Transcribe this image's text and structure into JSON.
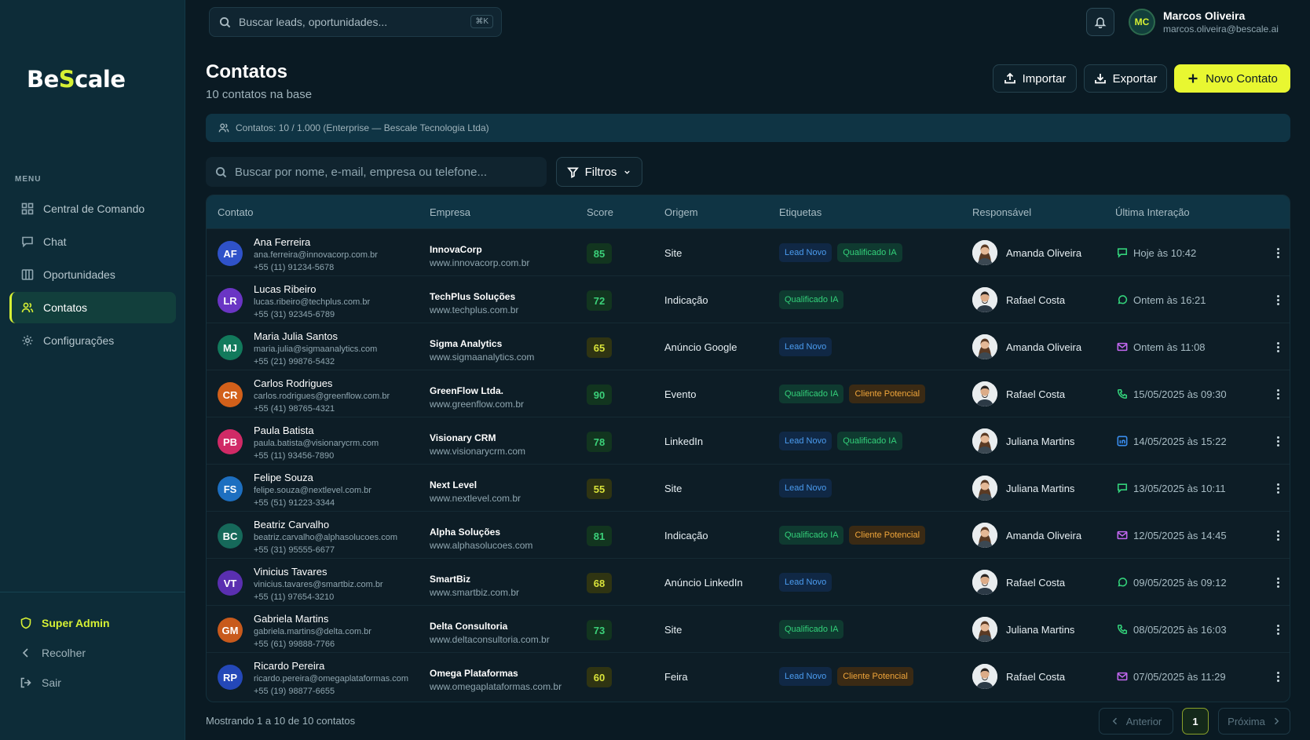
{
  "brand": {
    "part1": "Be",
    "part2": "S",
    "part3": "cale"
  },
  "colors": {
    "accent": "#e8f731",
    "bg": "#0a1a23",
    "sidebar": "#0d2c38"
  },
  "sidebar": {
    "menu_title": "MENU",
    "items": [
      {
        "label": "Central de Comando",
        "icon": "grid-icon"
      },
      {
        "label": "Chat",
        "icon": "chat-icon"
      },
      {
        "label": "Oportunidades",
        "icon": "columns-icon"
      },
      {
        "label": "Contatos",
        "icon": "users-icon",
        "active": true
      },
      {
        "label": "Configurações",
        "icon": "gear-icon"
      }
    ],
    "bottom": {
      "admin": "Super Admin",
      "collapse": "Recolher",
      "logout": "Sair"
    }
  },
  "topbar": {
    "search_placeholder": "Buscar leads, oportunidades...",
    "shortcut": "⌘K",
    "user": {
      "initials": "MC",
      "name": "Marcos Oliveira",
      "email": "marcos.oliveira@bescale.ai"
    }
  },
  "page": {
    "title": "Contatos",
    "subtitle": "10 contatos na base",
    "import_label": "Importar",
    "export_label": "Exportar",
    "new_label": "Novo Contato",
    "quota": "Contatos: 10 / 1.000 (Enterprise — Bescale Tecnologia Ltda)",
    "search_placeholder": "Buscar por nome, e-mail, empresa ou telefone...",
    "filter_label": "Filtros"
  },
  "table": {
    "headers": [
      "Contato",
      "Empresa",
      "Score",
      "Origem",
      "Etiquetas",
      "Responsável",
      "Última Interação"
    ],
    "rows": [
      {
        "initials": "AF",
        "avatar_color": "#2f52c9",
        "name": "Ana Ferreira",
        "email": "ana.ferreira@innovacorp.com.br",
        "phone": "+55 (11) 91234-5678",
        "company": "InnovaCorp",
        "site": "www.innovacorp.com.br",
        "score": "85",
        "score_level": "high",
        "origin": "Site",
        "tags": [
          "Lead Novo",
          "Qualificado IA"
        ],
        "owner": "Amanda Oliveira",
        "owner_gender": "f",
        "channel": "chat",
        "last": "Hoje às 10:42"
      },
      {
        "initials": "LR",
        "avatar_color": "#6a35c4",
        "name": "Lucas Ribeiro",
        "email": "lucas.ribeiro@techplus.com.br",
        "phone": "+55 (31) 92345-6789",
        "company": "TechPlus Soluções",
        "site": "www.techplus.com.br",
        "score": "72",
        "score_level": "high",
        "origin": "Indicação",
        "tags": [
          "Qualificado IA"
        ],
        "owner": "Rafael Costa",
        "owner_gender": "m",
        "channel": "whatsapp",
        "last": "Ontem às 16:21"
      },
      {
        "initials": "MJ",
        "avatar_color": "#127a5c",
        "name": "Maria Julia Santos",
        "email": "maria.julia@sigmaanalytics.com",
        "phone": "+55 (21) 99876-5432",
        "company": "Sigma Analytics",
        "site": "www.sigmaanalytics.com",
        "score": "65",
        "score_level": "mid",
        "origin": "Anúncio Google",
        "tags": [
          "Lead Novo"
        ],
        "owner": "Amanda Oliveira",
        "owner_gender": "f",
        "channel": "email",
        "last": "Ontem às 11:08"
      },
      {
        "initials": "CR",
        "avatar_color": "#d2601a",
        "name": "Carlos Rodrigues",
        "email": "carlos.rodrigues@greenflow.com.br",
        "phone": "+55 (41) 98765-4321",
        "company": "GreenFlow Ltda.",
        "site": "www.greenflow.com.br",
        "score": "90",
        "score_level": "high",
        "origin": "Evento",
        "tags": [
          "Qualificado IA",
          "Cliente Potencial"
        ],
        "owner": "Rafael Costa",
        "owner_gender": "m",
        "channel": "phone",
        "last": "15/05/2025 às 09:30"
      },
      {
        "initials": "PB",
        "avatar_color": "#d02a66",
        "name": "Paula Batista",
        "email": "paula.batista@visionarycrm.com",
        "phone": "+55 (11) 93456-7890",
        "company": "Visionary CRM",
        "site": "www.visionarycrm.com",
        "score": "78",
        "score_level": "high",
        "origin": "LinkedIn",
        "tags": [
          "Lead Novo",
          "Qualificado IA"
        ],
        "owner": "Juliana Martins",
        "owner_gender": "f",
        "channel": "linkedin",
        "last": "14/05/2025 às 15:22"
      },
      {
        "initials": "FS",
        "avatar_color": "#1d6fc0",
        "name": "Felipe Souza",
        "email": "felipe.souza@nextlevel.com.br",
        "phone": "+55 (51) 91223-3344",
        "company": "Next Level",
        "site": "www.nextlevel.com.br",
        "score": "55",
        "score_level": "mid",
        "origin": "Site",
        "tags": [
          "Lead Novo"
        ],
        "owner": "Juliana Martins",
        "owner_gender": "f",
        "channel": "chat",
        "last": "13/05/2025 às 10:11"
      },
      {
        "initials": "BC",
        "avatar_color": "#16695a",
        "name": "Beatriz Carvalho",
        "email": "beatriz.carvalho@alphasolucoes.com",
        "phone": "+55 (31) 95555-6677",
        "company": "Alpha Soluções",
        "site": "www.alphasolucoes.com",
        "score": "81",
        "score_level": "high",
        "origin": "Indicação",
        "tags": [
          "Qualificado IA",
          "Cliente Potencial"
        ],
        "owner": "Amanda Oliveira",
        "owner_gender": "f",
        "channel": "email",
        "last": "12/05/2025 às 14:45"
      },
      {
        "initials": "VT",
        "avatar_color": "#5a2fb0",
        "name": "Vinicius Tavares",
        "email": "vinicius.tavares@smartbiz.com.br",
        "phone": "+55 (11) 97654-3210",
        "company": "SmartBiz",
        "site": "www.smartbiz.com.br",
        "score": "68",
        "score_level": "mid",
        "origin": "Anúncio LinkedIn",
        "tags": [
          "Lead Novo"
        ],
        "owner": "Rafael Costa",
        "owner_gender": "m",
        "channel": "whatsapp",
        "last": "09/05/2025 às 09:12"
      },
      {
        "initials": "GM",
        "avatar_color": "#c85a1c",
        "name": "Gabriela Martins",
        "email": "gabriela.martins@delta.com.br",
        "phone": "+55 (61) 99888-7766",
        "company": "Delta Consultoria",
        "site": "www.deltaconsultoria.com.br",
        "score": "73",
        "score_level": "high",
        "origin": "Site",
        "tags": [
          "Qualificado IA"
        ],
        "owner": "Juliana Martins",
        "owner_gender": "f",
        "channel": "phone",
        "last": "08/05/2025 às 16:03"
      },
      {
        "initials": "RP",
        "avatar_color": "#2448b8",
        "name": "Ricardo Pereira",
        "email": "ricardo.pereira@omegaplataformas.com",
        "phone": "+55 (19) 98877-6655",
        "company": "Omega Plataformas",
        "site": "www.omegaplataformas.com.br",
        "score": "60",
        "score_level": "mid",
        "origin": "Feira",
        "tags": [
          "Lead Novo",
          "Cliente Potencial"
        ],
        "owner": "Rafael Costa",
        "owner_gender": "m",
        "channel": "email",
        "last": "07/05/2025 às 11:29"
      }
    ]
  },
  "pagination": {
    "summary": "Mostrando 1 a 10 de 10 contatos",
    "prev": "Anterior",
    "page": "1",
    "next": "Próxima"
  }
}
